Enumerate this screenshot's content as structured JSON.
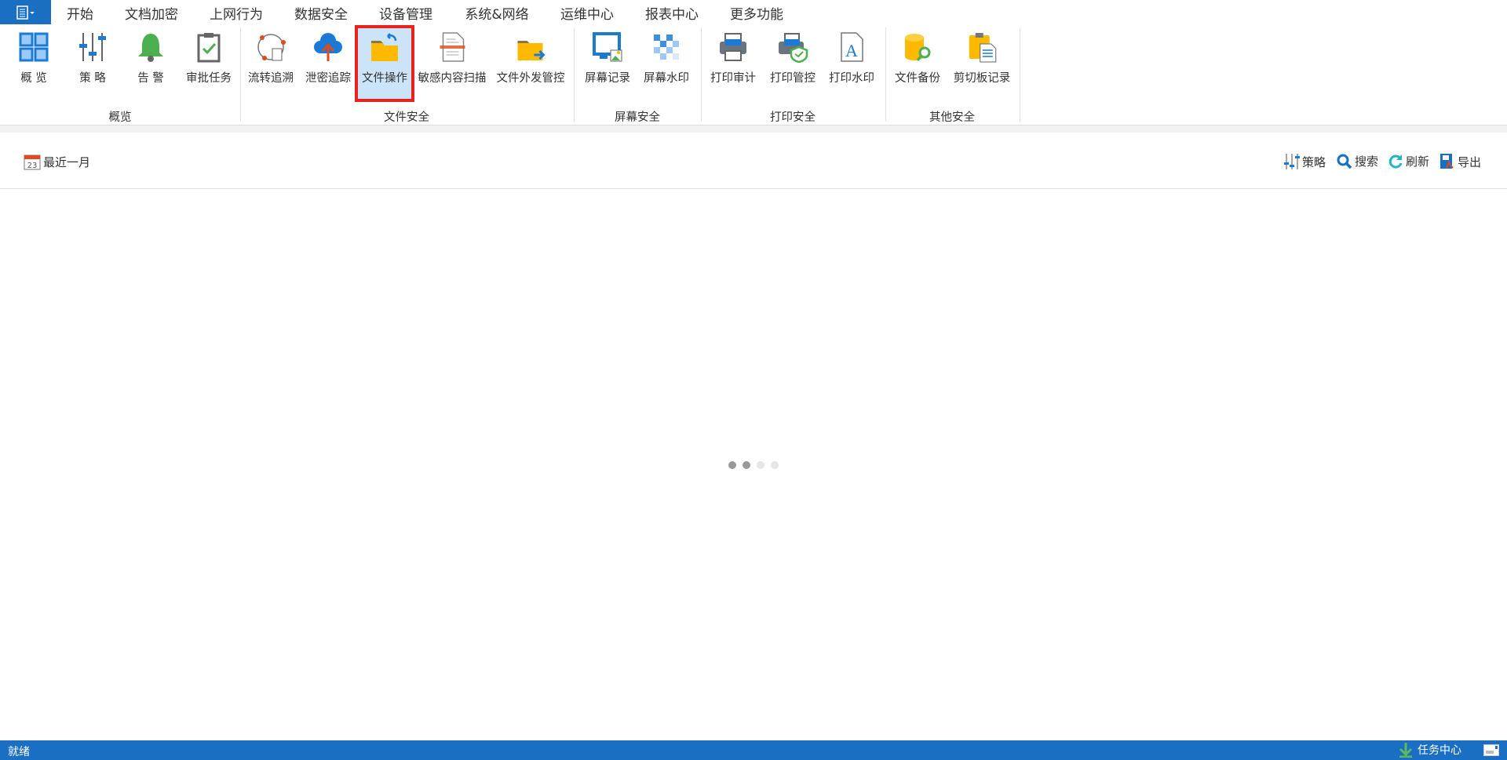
{
  "menu_button": {
    "icon": "app-menu-icon"
  },
  "tabs": [
    {
      "label": "开始"
    },
    {
      "label": "文档加密"
    },
    {
      "label": "上网行为"
    },
    {
      "label": "数据安全",
      "active": true
    },
    {
      "label": "设备管理"
    },
    {
      "label": "系统&网络"
    },
    {
      "label": "运维中心"
    },
    {
      "label": "报表中心"
    },
    {
      "label": "更多功能"
    }
  ],
  "ribbon": {
    "groups": [
      {
        "label": "概览"
      },
      {
        "label": "文件安全"
      },
      {
        "label": "屏幕安全"
      },
      {
        "label": "打印安全"
      },
      {
        "label": "其他安全"
      }
    ],
    "buttons": [
      {
        "label": "概 览",
        "icon": "grid-overview-icon"
      },
      {
        "label": "策 略",
        "icon": "sliders-icon"
      },
      {
        "label": "告 警",
        "icon": "bell-icon"
      },
      {
        "label": "审批任务",
        "icon": "clipboard-check-icon"
      },
      {
        "label": "流转追溯",
        "icon": "flow-trace-icon"
      },
      {
        "label": "泄密追踪",
        "icon": "cloud-upload-icon"
      },
      {
        "label": "文件操作",
        "icon": "folder-return-icon",
        "selected": true
      },
      {
        "label": "敏感内容扫描",
        "icon": "document-scan-icon"
      },
      {
        "label": "文件外发管控",
        "icon": "folder-send-icon"
      },
      {
        "label": "屏幕记录",
        "icon": "monitor-image-icon"
      },
      {
        "label": "屏幕水印",
        "icon": "mosaic-icon"
      },
      {
        "label": "打印审计",
        "icon": "printer-icon"
      },
      {
        "label": "打印管控",
        "icon": "printer-shield-icon"
      },
      {
        "label": "打印水印",
        "icon": "document-letter-icon"
      },
      {
        "label": "文件备份",
        "icon": "database-search-icon"
      },
      {
        "label": "剪切板记录",
        "icon": "clipboard-document-icon"
      }
    ]
  },
  "toolbar": {
    "date_range": "最近一月",
    "date_icon": "calendar-icon",
    "calendar_day": "23",
    "policy": "策略",
    "search": "搜索",
    "refresh": "刷新",
    "export": "导出"
  },
  "status": {
    "text": "就绪",
    "task_center": "任务中心"
  },
  "colors": {
    "accent": "#1a6fc2",
    "selection_border": "#e8231e",
    "selection_fill": "#cce4f7"
  }
}
